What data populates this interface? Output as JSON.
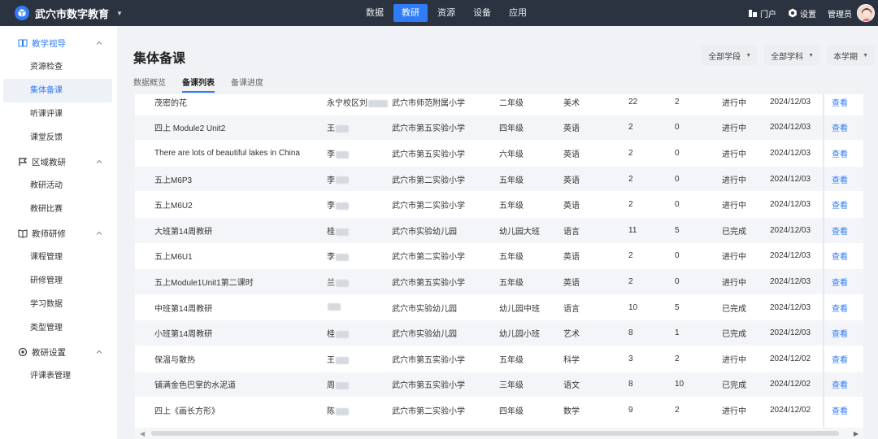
{
  "header": {
    "brand_title": "武穴市数字教育",
    "nav": [
      {
        "label": "数据",
        "active": false
      },
      {
        "label": "教研",
        "active": true
      },
      {
        "label": "资源",
        "active": false
      },
      {
        "label": "设备",
        "active": false
      },
      {
        "label": "应用",
        "active": false
      }
    ],
    "portal_label": "门户",
    "settings_label": "设置",
    "user_label": "管理员",
    "accent_color": "#2f7cf6",
    "bar_color": "#2b3340"
  },
  "sidebar": {
    "groups": [
      {
        "label": "教学视导",
        "icon": "book-icon",
        "items": [
          "资源检查",
          "集体备课",
          "听课评课",
          "课堂反馈"
        ]
      },
      {
        "label": "区域教研",
        "icon": "flag-icon",
        "items": [
          "教研活动",
          "教研比赛"
        ]
      },
      {
        "label": "教师研修",
        "icon": "open-book-icon",
        "items": [
          "课程管理",
          "研修管理",
          "学习数据",
          "类型管理"
        ]
      },
      {
        "label": "教研设置",
        "icon": "settings-icon",
        "items": [
          "评课表管理"
        ]
      }
    ],
    "active_item": "集体备课"
  },
  "main": {
    "title": "集体备课",
    "filters": [
      "全部学段",
      "全部学科",
      "本学期"
    ],
    "tabs": [
      {
        "label": "数据概览",
        "active": false
      },
      {
        "label": "备课列表",
        "active": true
      },
      {
        "label": "备课进度",
        "active": false
      }
    ],
    "rows": [
      {
        "title": "茂密的花",
        "teacher": "永宁校区刘",
        "school": "武穴市师范附属小学",
        "grade": "二年级",
        "subject": "美术",
        "n1": "22",
        "n2": "2",
        "status": "进行中",
        "date": "2024/12/03",
        "action": "查看"
      },
      {
        "title": "四上 Module2 Unit2",
        "teacher": "王",
        "school": "武穴市第五实验小学",
        "grade": "四年级",
        "subject": "英语",
        "n1": "2",
        "n2": "0",
        "status": "进行中",
        "date": "2024/12/03",
        "action": "查看"
      },
      {
        "title": "There are lots of beautiful lakes in China",
        "teacher": "李",
        "school": "武穴市第五实验小学",
        "grade": "六年级",
        "subject": "英语",
        "n1": "2",
        "n2": "0",
        "status": "进行中",
        "date": "2024/12/03",
        "action": "查看"
      },
      {
        "title": "五上M6P3",
        "teacher": "李",
        "school": "武穴市第二实验小学",
        "grade": "五年级",
        "subject": "英语",
        "n1": "2",
        "n2": "0",
        "status": "进行中",
        "date": "2024/12/03",
        "action": "查看"
      },
      {
        "title": "五上M6U2",
        "teacher": "李",
        "school": "武穴市第二实验小学",
        "grade": "五年级",
        "subject": "英语",
        "n1": "2",
        "n2": "0",
        "status": "进行中",
        "date": "2024/12/03",
        "action": "查看"
      },
      {
        "title": "大班第14周教研",
        "teacher": "桂",
        "school": "武穴市实验幼儿园",
        "grade": "幼儿园大班",
        "subject": "语言",
        "n1": "11",
        "n2": "5",
        "status": "已完成",
        "date": "2024/12/03",
        "action": "查看"
      },
      {
        "title": "五上M6U1",
        "teacher": "李",
        "school": "武穴市第二实验小学",
        "grade": "五年级",
        "subject": "英语",
        "n1": "2",
        "n2": "0",
        "status": "进行中",
        "date": "2024/12/03",
        "action": "查看"
      },
      {
        "title": "五上Module1Unit1第二课时",
        "teacher": "兰",
        "school": "武穴市第五实验小学",
        "grade": "五年级",
        "subject": "英语",
        "n1": "2",
        "n2": "0",
        "status": "进行中",
        "date": "2024/12/03",
        "action": "查看"
      },
      {
        "title": "中班第14周教研",
        "teacher": "",
        "school": "武穴市实验幼儿园",
        "grade": "幼儿园中班",
        "subject": "语言",
        "n1": "10",
        "n2": "5",
        "status": "已完成",
        "date": "2024/12/03",
        "action": "查看"
      },
      {
        "title": "小班第14周教研",
        "teacher": "桂",
        "school": "武穴市实验幼儿园",
        "grade": "幼儿园小班",
        "subject": "艺术",
        "n1": "8",
        "n2": "1",
        "status": "已完成",
        "date": "2024/12/03",
        "action": "查看"
      },
      {
        "title": "保温与散热",
        "teacher": "王",
        "school": "武穴市第五实验小学",
        "grade": "五年级",
        "subject": "科学",
        "n1": "3",
        "n2": "2",
        "status": "进行中",
        "date": "2024/12/02",
        "action": "查看"
      },
      {
        "title": "铺满金色巴掌的水泥道",
        "teacher": "周",
        "school": "武穴市第五实验小学",
        "grade": "三年级",
        "subject": "语文",
        "n1": "8",
        "n2": "10",
        "status": "已完成",
        "date": "2024/12/02",
        "action": "查看"
      },
      {
        "title": "四上《画长方形》",
        "teacher": "陈",
        "school": "武穴市第二实验小学",
        "grade": "四年级",
        "subject": "数学",
        "n1": "9",
        "n2": "2",
        "status": "进行中",
        "date": "2024/12/02",
        "action": "查看"
      }
    ]
  }
}
